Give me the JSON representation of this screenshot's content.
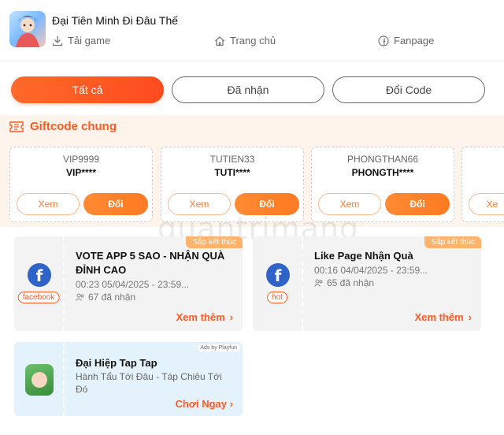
{
  "header": {
    "title": "Đại Tiên Minh Đi Đâu Thế",
    "links": {
      "download": "Tải game",
      "home": "Trang chủ",
      "fanpage": "Fanpage"
    }
  },
  "tabs": {
    "all": "Tất cả",
    "received": "Đã nhận",
    "exchange": "Đổi Code"
  },
  "giftcode": {
    "title": "Giftcode chung",
    "cards": [
      {
        "code": "VIP9999",
        "masked": "VIP****",
        "view": "Xem",
        "swap": "Đổi"
      },
      {
        "code": "TUTIEN33",
        "masked": "TUTI****",
        "view": "Xem",
        "swap": "Đổi"
      },
      {
        "code": "PHONGTHAN66",
        "masked": "PHONGTH****",
        "view": "Xem",
        "swap": "Đổi"
      },
      {
        "code": "",
        "masked": "",
        "view": "Xe",
        "swap": ""
      }
    ]
  },
  "events": [
    {
      "ribbon": "Sắp kết thúc",
      "tag": "facebook",
      "title": "VOTE APP 5 SAO - NHẬN QUÀ ĐỈNH CAO",
      "time": "00:23 05/04/2025 - 23:59...",
      "count": "67 đã nhận",
      "more": "Xem thêm"
    },
    {
      "ribbon": "Sắp kết thúc",
      "tag": "hot",
      "title": "Like Page Nhận Quà",
      "time": "00:16 04/04/2025 - 23:59...",
      "count": "65 đã nhận",
      "more": "Xem thêm"
    }
  ],
  "ad": {
    "badge": "Ads by Playfun",
    "title": "Đại Hiệp Tap Tap",
    "desc": "Hành Tẩu Tới Đâu - Táp Chiêu Tới Đó",
    "cta": "Chơi Ngay"
  },
  "watermark": "quantrimang",
  "colors": {
    "accent": "#ff5a24",
    "button": "#ff7a22",
    "band": "#fff4ec",
    "card": "#f3f3f3",
    "ad_bg": "#e4f3fb",
    "facebook": "#2f63c7"
  }
}
